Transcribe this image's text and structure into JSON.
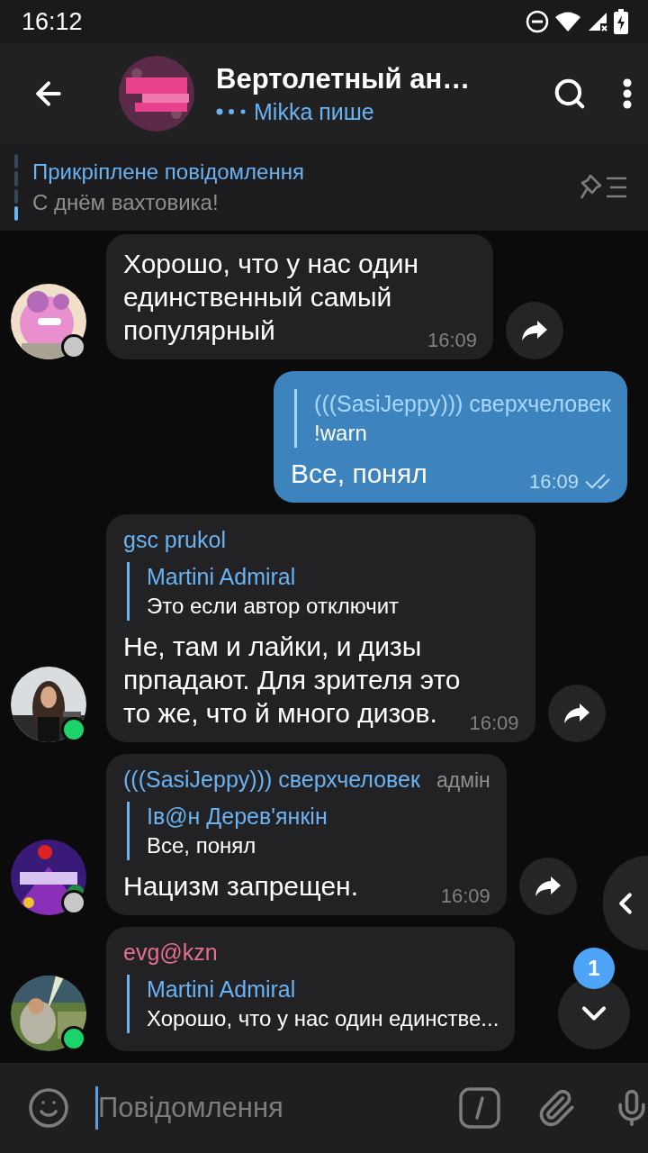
{
  "status_bar": {
    "time": "16:12"
  },
  "header": {
    "title": "Вертолетный ан…",
    "subtitle": "Mikka пише"
  },
  "pinned": {
    "label": "Прикріплене повідомлення",
    "text": "С днём вахтовика!"
  },
  "messages": [
    {
      "kind": "incoming",
      "online": false,
      "text": "Хорошо, что у нас один\nединственный самый\nпопулярный",
      "time": "16:09",
      "forward": true
    },
    {
      "kind": "outgoing",
      "reply": {
        "author": "(((SasiJeppy))) сверхчеловек",
        "text": "!warn"
      },
      "text": "Все, понял",
      "time": "16:09",
      "read": true
    },
    {
      "kind": "incoming",
      "online": true,
      "author": "gsc prukol",
      "color": "#6ab3f3",
      "reply": {
        "author": "Martini Admiral",
        "text": "Это если автор отключит"
      },
      "text": "Не, там и лайки, и дизы\nпрпадают. Для зрителя это\nто же, что й много дизов.",
      "time": "16:09",
      "forward": true
    },
    {
      "kind": "incoming",
      "online": false,
      "author": "(((SasiJeppy))) сверхчеловек",
      "color": "#6ab3f3",
      "role": "адмін",
      "reply": {
        "author": "Ів@н Дерев'янкін",
        "text": "Все, понял"
      },
      "text": "Нацизм запрещен.",
      "time": "16:09",
      "forward": true
    },
    {
      "kind": "incoming",
      "online": true,
      "author": "evg@kzn",
      "color": "#e56f8c",
      "reply": {
        "author": "Martini Admiral",
        "text": "Хорошо, что у нас один единстве..."
      }
    }
  ],
  "unread_badge": "1",
  "composer": {
    "placeholder": "Повідомлення"
  }
}
